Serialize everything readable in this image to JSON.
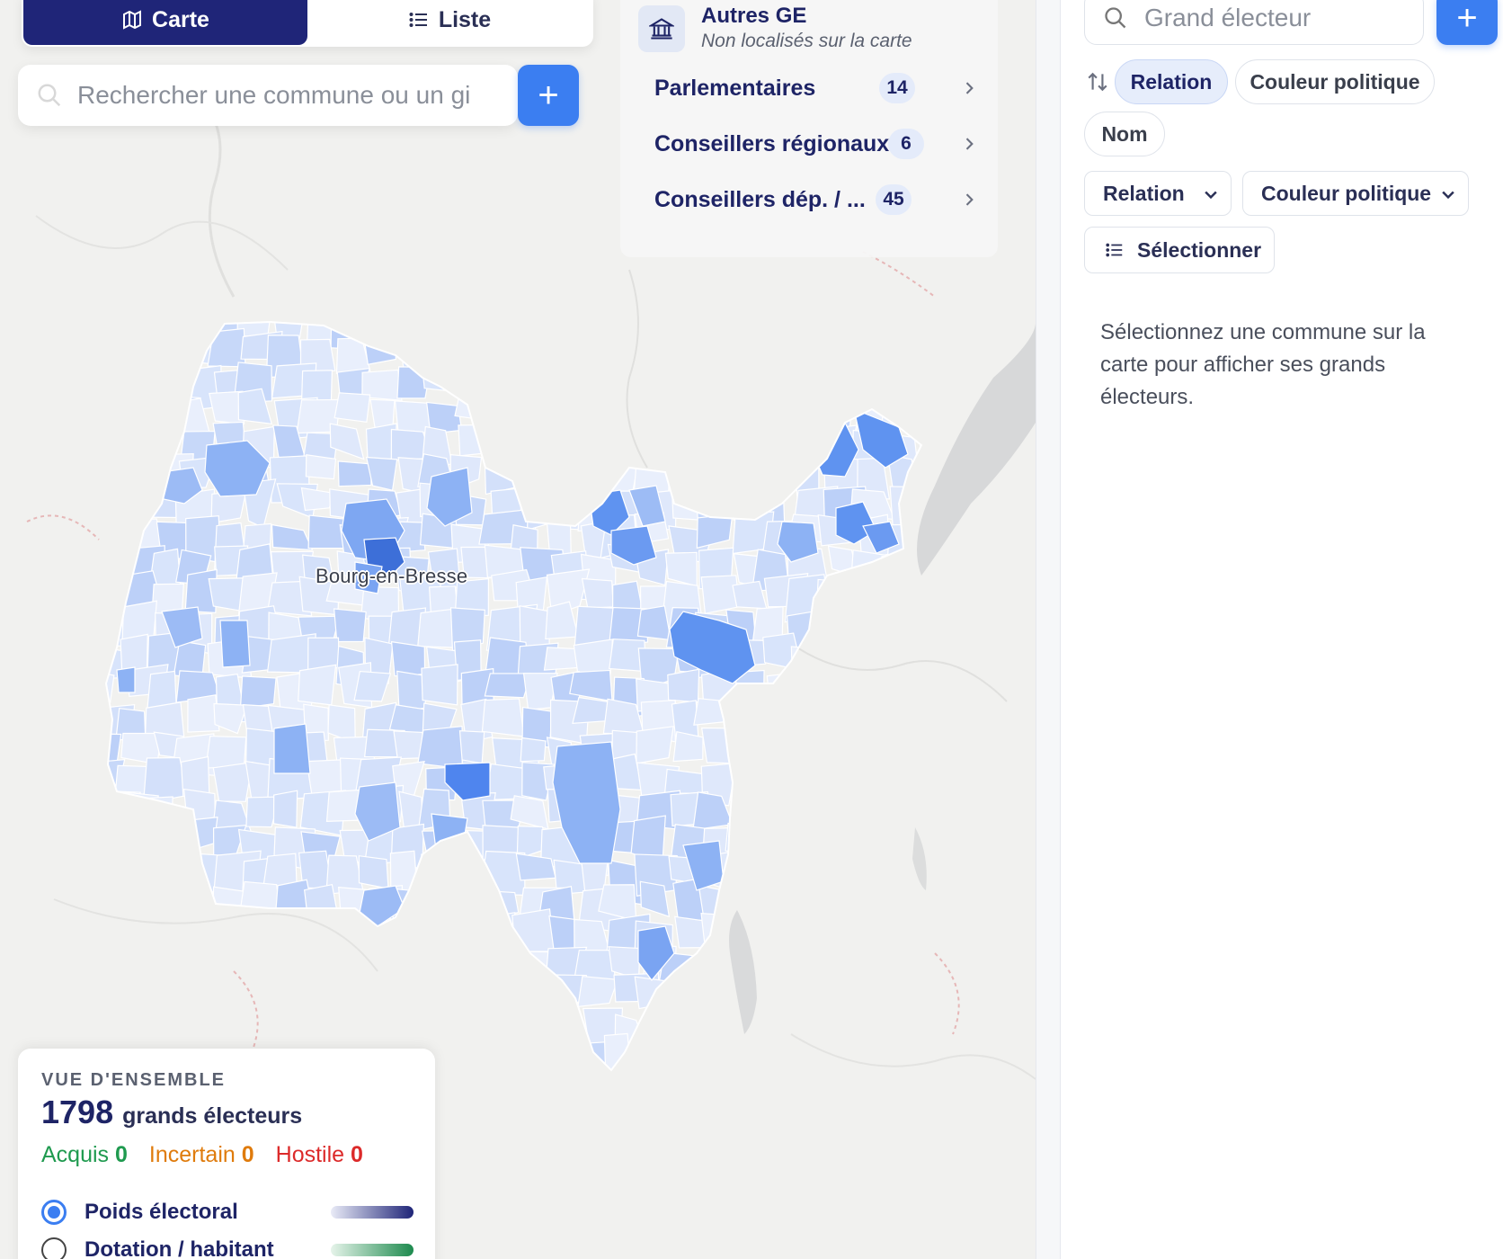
{
  "view_toggle": {
    "map_label": "Carte",
    "list_label": "Liste"
  },
  "search": {
    "placeholder": "Rechercher une commune ou un gi",
    "add_label": "+"
  },
  "map": {
    "city_label": "Bourg-en-Bresse",
    "colors": {
      "fill_light": "#e8eefc",
      "fill_mid": "#c3d5fa",
      "fill_dark": "#5f93f0",
      "fill_darkest": "#3d6fd8",
      "border": "#ffffff"
    }
  },
  "other_ge": {
    "title": "Autres GE",
    "subtitle": "Non localisés sur la carte",
    "icon": "bank-icon",
    "rows": [
      {
        "label": "Parlementaires",
        "count": "14"
      },
      {
        "label": "Conseillers régionaux",
        "count": "6"
      },
      {
        "label": "Conseillers dép. / ...",
        "count": "45"
      }
    ]
  },
  "legend": {
    "title": "VUE D'ENSEMBLE",
    "count": "1798",
    "count_unit": "grands électeurs",
    "stats": [
      {
        "label": "Acquis",
        "value": "0",
        "color": "#1f9a4f"
      },
      {
        "label": "Incertain",
        "value": "0",
        "color": "#df7b0c"
      },
      {
        "label": "Hostile",
        "value": "0",
        "color": "#dc2a2a"
      }
    ],
    "options": [
      {
        "label": "Poids électoral",
        "selected": true,
        "gradient": [
          "#e9ebf7",
          "#1f2578"
        ]
      },
      {
        "label": "Dotation / habitant",
        "selected": false,
        "gradient": [
          "#e6f4ea",
          "#1d8a4e"
        ]
      }
    ]
  },
  "sidebar": {
    "search_placeholder": "Grand électeur",
    "add_label": "+",
    "sort_chips": [
      {
        "label": "Relation",
        "active": true
      },
      {
        "label": "Couleur politique",
        "active": false
      },
      {
        "label": "Nom",
        "active": false
      }
    ],
    "filters": [
      {
        "label": "Relation"
      },
      {
        "label": "Couleur politique"
      }
    ],
    "select_label": "Sélectionner",
    "empty_message": "Sélectionnez une commune sur la carte pour afficher ses grands électeurs."
  },
  "accent_color": "#3b7ef1",
  "navy_color": "#1f2578"
}
